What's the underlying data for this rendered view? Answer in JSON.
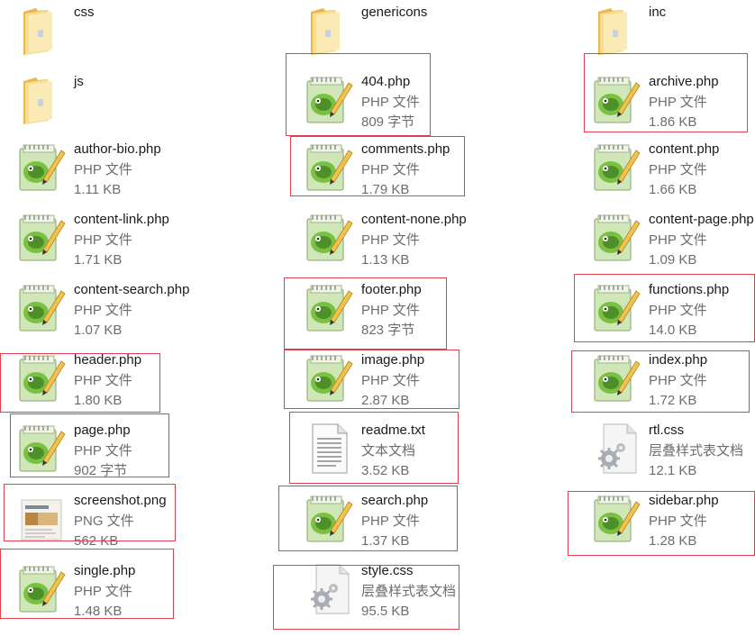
{
  "files": [
    {
      "name": "css",
      "type": "",
      "size": "",
      "icon": "folder-icon",
      "highlighted": false
    },
    {
      "name": "genericons",
      "type": "",
      "size": "",
      "icon": "folder-icon",
      "highlighted": false
    },
    {
      "name": "inc",
      "type": "",
      "size": "",
      "icon": "folder-icon",
      "highlighted": false
    },
    {
      "name": "js",
      "type": "",
      "size": "",
      "icon": "folder-icon",
      "highlighted": false
    },
    {
      "name": "404.php",
      "type": "PHP 文件",
      "size": "809 字节",
      "icon": "notepad-plus-plus-icon",
      "highlighted": true
    },
    {
      "name": "archive.php",
      "type": "PHP 文件",
      "size": "1.86 KB",
      "icon": "notepad-plus-plus-icon",
      "highlighted": true
    },
    {
      "name": "author-bio.php",
      "type": "PHP 文件",
      "size": "1.11 KB",
      "icon": "notepad-plus-plus-icon",
      "highlighted": false
    },
    {
      "name": "comments.php",
      "type": "PHP 文件",
      "size": "1.79 KB",
      "icon": "notepad-plus-plus-icon",
      "highlighted": true
    },
    {
      "name": "content.php",
      "type": "PHP 文件",
      "size": "1.66 KB",
      "icon": "notepad-plus-plus-icon",
      "highlighted": false
    },
    {
      "name": "content-link.php",
      "type": "PHP 文件",
      "size": "1.71 KB",
      "icon": "notepad-plus-plus-icon",
      "highlighted": false
    },
    {
      "name": "content-none.php",
      "type": "PHP 文件",
      "size": "1.13 KB",
      "icon": "notepad-plus-plus-icon",
      "highlighted": false
    },
    {
      "name": "content-page.php",
      "type": "PHP 文件",
      "size": "1.09 KB",
      "icon": "notepad-plus-plus-icon",
      "highlighted": false
    },
    {
      "name": "content-search.php",
      "type": "PHP 文件",
      "size": "1.07 KB",
      "icon": "notepad-plus-plus-icon",
      "highlighted": false
    },
    {
      "name": "footer.php",
      "type": "PHP 文件",
      "size": "823 字节",
      "icon": "notepad-plus-plus-icon",
      "highlighted": true
    },
    {
      "name": "functions.php",
      "type": "PHP 文件",
      "size": "14.0 KB",
      "icon": "notepad-plus-plus-icon",
      "highlighted": true
    },
    {
      "name": "header.php",
      "type": "PHP 文件",
      "size": "1.80 KB",
      "icon": "notepad-plus-plus-icon",
      "highlighted": true
    },
    {
      "name": "image.php",
      "type": "PHP 文件",
      "size": "2.87 KB",
      "icon": "notepad-plus-plus-icon",
      "highlighted": true
    },
    {
      "name": "index.php",
      "type": "PHP 文件",
      "size": "1.72 KB",
      "icon": "notepad-plus-plus-icon",
      "highlighted": true
    },
    {
      "name": "page.php",
      "type": "PHP 文件",
      "size": "902 字节",
      "icon": "notepad-plus-plus-icon",
      "highlighted": true
    },
    {
      "name": "readme.txt",
      "type": "文本文档",
      "size": "3.52 KB",
      "icon": "text-document-icon",
      "highlighted": true
    },
    {
      "name": "rtl.css",
      "type": "层叠样式表文档",
      "size": "12.1 KB",
      "icon": "css-document-icon",
      "highlighted": false
    },
    {
      "name": "screenshot.png",
      "type": "PNG 文件",
      "size": "562 KB",
      "icon": "image-thumbnail-icon",
      "highlighted": true
    },
    {
      "name": "search.php",
      "type": "PHP 文件",
      "size": "1.37 KB",
      "icon": "notepad-plus-plus-icon",
      "highlighted": true
    },
    {
      "name": "sidebar.php",
      "type": "PHP 文件",
      "size": "1.28 KB",
      "icon": "notepad-plus-plus-icon",
      "highlighted": true
    },
    {
      "name": "single.php",
      "type": "PHP 文件",
      "size": "1.48 KB",
      "icon": "notepad-plus-plus-icon",
      "highlighted": true
    },
    {
      "name": "style.css",
      "type": "层叠样式表文档",
      "size": "95.5 KB",
      "icon": "css-document-icon",
      "highlighted": true
    }
  ],
  "colors": {
    "highlight_border": "#e0404a",
    "folder": "#f3c862",
    "npp_green": "#7ac143"
  }
}
